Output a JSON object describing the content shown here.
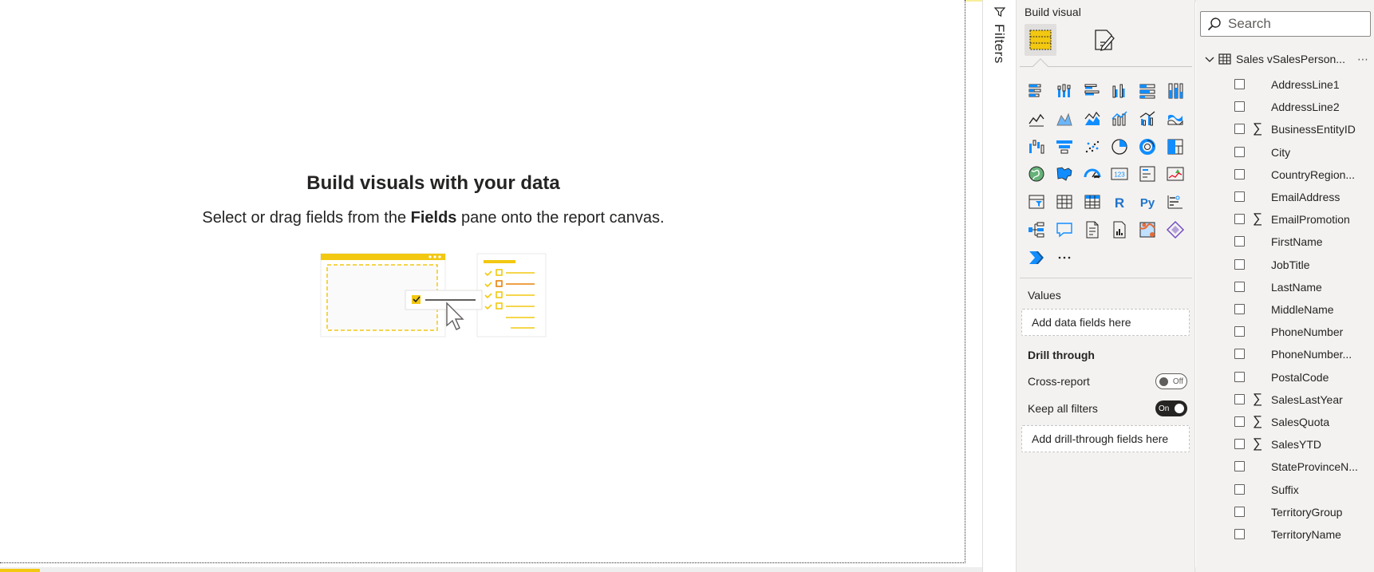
{
  "canvas": {
    "empty_title": "Build visuals with your data",
    "empty_sub_before": "Select or drag fields from the ",
    "empty_sub_bold": "Fields",
    "empty_sub_after": " pane onto the report canvas."
  },
  "filters": {
    "label": "Filters"
  },
  "viz_pane": {
    "title": "Build visual",
    "tabs": [
      {
        "name": "build-visual-tab",
        "icon": "build-visual-icon",
        "selected": true
      },
      {
        "name": "format-visual-tab",
        "icon": "format-visual-icon",
        "selected": false
      }
    ],
    "visuals": [
      "stacked-bar-chart-icon",
      "stacked-column-chart-icon",
      "clustered-bar-chart-icon",
      "clustered-column-chart-icon",
      "100-stacked-bar-chart-icon",
      "100-stacked-column-chart-icon",
      "line-chart-icon",
      "area-chart-icon",
      "stacked-area-chart-icon",
      "line-and-stacked-column-chart-icon",
      "line-and-clustered-column-chart-icon",
      "ribbon-chart-icon",
      "waterfall-chart-icon",
      "funnel-icon",
      "scatter-chart-icon",
      "pie-chart-icon",
      "donut-chart-icon",
      "treemap-icon",
      "map-icon",
      "filled-map-icon",
      "gauge-icon",
      "card-icon",
      "multi-row-card-icon",
      "kpi-icon",
      "slicer-icon",
      "table-icon",
      "matrix-icon",
      "r-script-visual-icon",
      "python-visual-icon",
      "key-influencers-icon",
      "decomposition-tree-icon",
      "q-and-a-icon",
      "smart-narrative-icon",
      "paginated-report-icon",
      "azure-map-icon",
      "power-apps-icon",
      "power-automate-icon",
      "more-visuals-icon"
    ],
    "values_label": "Values",
    "values_placeholder": "Add data fields here",
    "drill_label": "Drill through",
    "cross_report_label": "Cross-report",
    "cross_report_state": "Off",
    "keep_filters_label": "Keep all filters",
    "keep_filters_state": "On",
    "drill_placeholder": "Add drill-through fields here"
  },
  "fields_pane": {
    "search_placeholder": "Search",
    "table_name": "Sales vSalesPerson...",
    "more": "⋯",
    "fields": [
      {
        "name": "AddressLine1",
        "sigma": false
      },
      {
        "name": "AddressLine2",
        "sigma": false
      },
      {
        "name": "BusinessEntityID",
        "sigma": true
      },
      {
        "name": "City",
        "sigma": false
      },
      {
        "name": "CountryRegion...",
        "sigma": false
      },
      {
        "name": "EmailAddress",
        "sigma": false
      },
      {
        "name": "EmailPromotion",
        "sigma": true
      },
      {
        "name": "FirstName",
        "sigma": false
      },
      {
        "name": "JobTitle",
        "sigma": false
      },
      {
        "name": "LastName",
        "sigma": false
      },
      {
        "name": "MiddleName",
        "sigma": false
      },
      {
        "name": "PhoneNumber",
        "sigma": false
      },
      {
        "name": "PhoneNumber...",
        "sigma": false
      },
      {
        "name": "PostalCode",
        "sigma": false
      },
      {
        "name": "SalesLastYear",
        "sigma": true
      },
      {
        "name": "SalesQuota",
        "sigma": true
      },
      {
        "name": "SalesYTD",
        "sigma": true
      },
      {
        "name": "StateProvinceN...",
        "sigma": false
      },
      {
        "name": "Suffix",
        "sigma": false
      },
      {
        "name": "TerritoryGroup",
        "sigma": false
      },
      {
        "name": "TerritoryName",
        "sigma": false
      }
    ]
  },
  "colors": {
    "accent": "#f2c811",
    "pane_bg": "#f3f2f1",
    "viz_blue": "#118dff",
    "text": "#252423"
  }
}
